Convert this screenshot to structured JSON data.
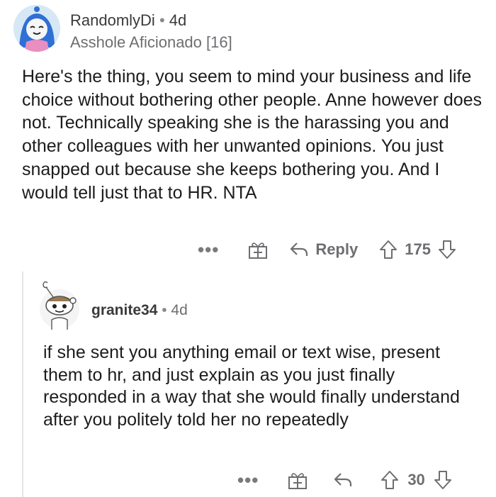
{
  "comments": [
    {
      "username": "RandomlyDi",
      "separator": "•",
      "age": "4d",
      "flair": "Asshole Aficionado [16]",
      "body": "Here's the thing, you seem to mind your business and life choice without bothering other people. Anne however does not. Technically speaking she is the harassing you and other colleagues with her unwanted opinions. You just snapped out because she keeps bothering you. And I would tell just that to HR. NTA",
      "actions": {
        "more": "•••",
        "reply": "Reply",
        "score": "175"
      },
      "avatar_icon": "snoo-avatar-blue-hair"
    },
    {
      "username": "granite34",
      "separator": "•",
      "age": "4d",
      "body": "if she sent you anything email or text wise, present them to hr, and just explain as you just finally responded in a way that she would finally understand after you politely told her no repeatedly",
      "actions": {
        "more": "•••",
        "score": "30"
      },
      "avatar_icon": "default-snoo-avatar"
    }
  ],
  "colors": {
    "text": "#1c1c1c",
    "meta": "#6e6e72",
    "thread_line": "#e5e5e5"
  }
}
